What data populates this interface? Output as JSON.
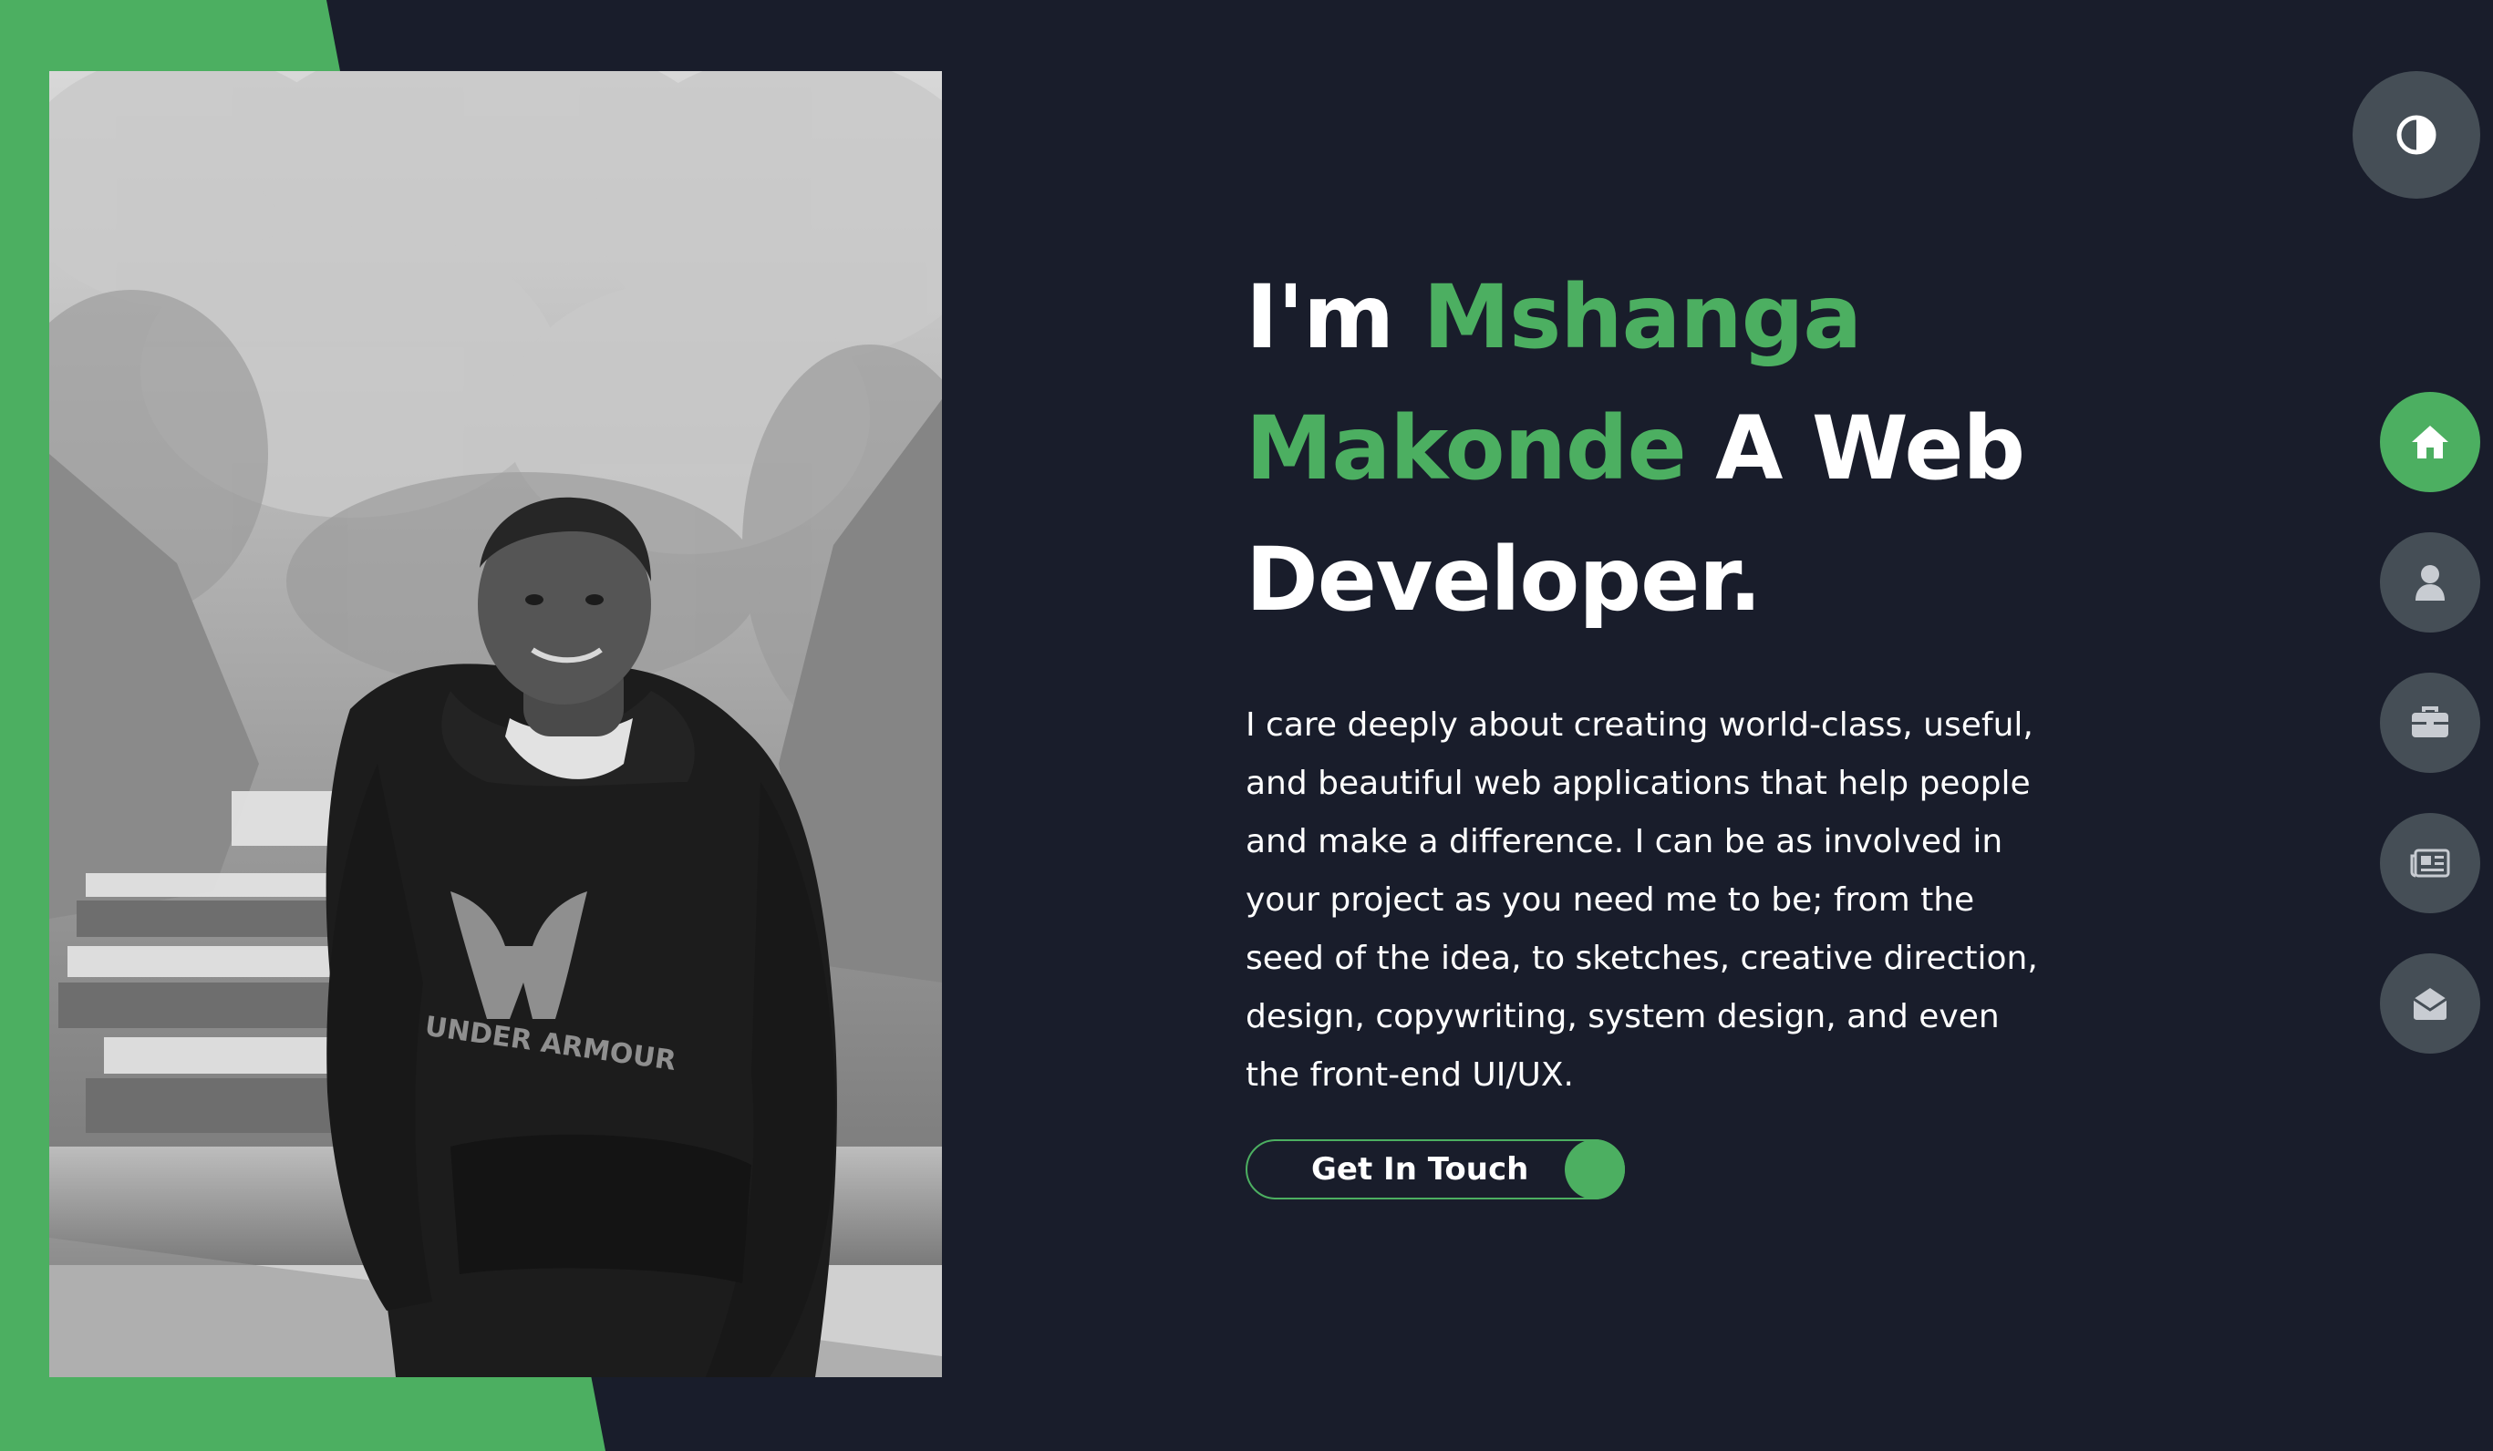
{
  "colors": {
    "background": "#191d2b",
    "accent": "#4caf61",
    "nav_button": "#454e56",
    "text": "#ffffff"
  },
  "hero": {
    "headline": {
      "prefix": "I'm ",
      "name": "Mshanga Makonde",
      "suffix": " A Web Developer."
    },
    "intro": "I care deeply about creating world-class, useful, and beautiful web applications that help people and make a difference. I can be as involved in your project as you need me to be; from the seed of the idea, to sketches, creative direction, design, copywriting, system design, and even the front-end UI/UX.",
    "cta_label": "Get In Touch"
  },
  "photo": {
    "sweatshirt_logo_text": "UNDER ARMOUR"
  },
  "theme_toggle": {
    "icon": "contrast-icon"
  },
  "nav": {
    "active": "home",
    "items": [
      {
        "id": "home",
        "icon": "home-icon"
      },
      {
        "id": "about",
        "icon": "user-icon"
      },
      {
        "id": "portfolio",
        "icon": "briefcase-icon"
      },
      {
        "id": "blog",
        "icon": "newspaper-icon"
      },
      {
        "id": "contact",
        "icon": "envelope-open-icon"
      }
    ]
  }
}
